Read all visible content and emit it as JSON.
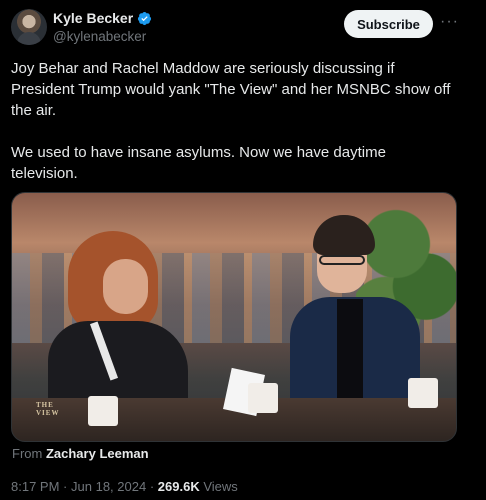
{
  "author": {
    "display_name": "Kyle Becker",
    "handle": "@kylenabecker",
    "verified": true,
    "avatar_icon": "avatar"
  },
  "actions": {
    "subscribe_label": "Subscribe",
    "more_icon": "ellipsis-icon",
    "more_label": "···"
  },
  "post": {
    "paragraphs": [
      "Joy Behar and Rachel Maddow are seriously discussing if President Trump would yank \"The View\" and her MSNBC show off the air.",
      "We used to have insane asylums. Now we have daytime television."
    ]
  },
  "media": {
    "credit_prefix": "From",
    "credit_name": "Zachary Leeman",
    "logo_text": "THE VIEW"
  },
  "meta": {
    "time": "8:17 PM",
    "separator": "·",
    "date": "Jun 18, 2024",
    "views_count": "269.6K",
    "views_label": "Views"
  },
  "colors": {
    "background": "#000000",
    "text": "#e7e9ea",
    "muted": "#71767b",
    "verified_blue": "#1d9bf0",
    "subscribe_bg": "#eff3f4"
  }
}
